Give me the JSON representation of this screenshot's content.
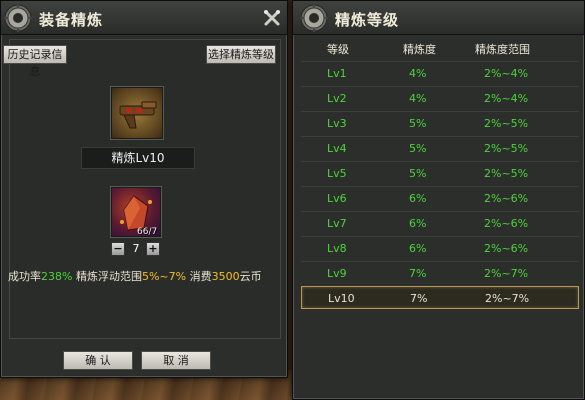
{
  "left_panel": {
    "title": "装备精炼",
    "history_button": "历史记录信息",
    "select_level_button": "选择精炼等级",
    "item_name": "精炼Lv10",
    "gem_count": "66/7",
    "stepper": {
      "minus": "−",
      "value": "7",
      "plus": "+"
    },
    "stats": {
      "success_label": "成功率",
      "success_value": "238%",
      "range_label": "精炼浮动范围",
      "range_value": "5%~7%",
      "cost_label": "消费",
      "cost_value": "3500",
      "currency": "云币"
    },
    "confirm_button": "确 认",
    "cancel_button": "取 消"
  },
  "right_panel": {
    "title": "精炼等级",
    "headers": [
      "等级",
      "精炼度",
      "精炼度范围"
    ],
    "rows": [
      {
        "level": "Lv1",
        "degree": "4%",
        "range": "2%~4%"
      },
      {
        "level": "Lv2",
        "degree": "4%",
        "range": "2%~4%"
      },
      {
        "level": "Lv3",
        "degree": "5%",
        "range": "2%~5%"
      },
      {
        "level": "Lv4",
        "degree": "5%",
        "range": "2%~5%"
      },
      {
        "level": "Lv5",
        "degree": "5%",
        "range": "2%~5%"
      },
      {
        "level": "Lv6",
        "degree": "6%",
        "range": "2%~6%"
      },
      {
        "level": "Lv7",
        "degree": "6%",
        "range": "2%~6%"
      },
      {
        "level": "Lv8",
        "degree": "6%",
        "range": "2%~6%"
      },
      {
        "level": "Lv9",
        "degree": "7%",
        "range": "2%~7%"
      },
      {
        "level": "Lv10",
        "degree": "7%",
        "range": "2%~7%"
      }
    ],
    "selected_row": 9
  },
  "colors": {
    "value_green": "#4cd43a",
    "value_yellow": "#f0c028",
    "selected_border": "#b99a52"
  }
}
